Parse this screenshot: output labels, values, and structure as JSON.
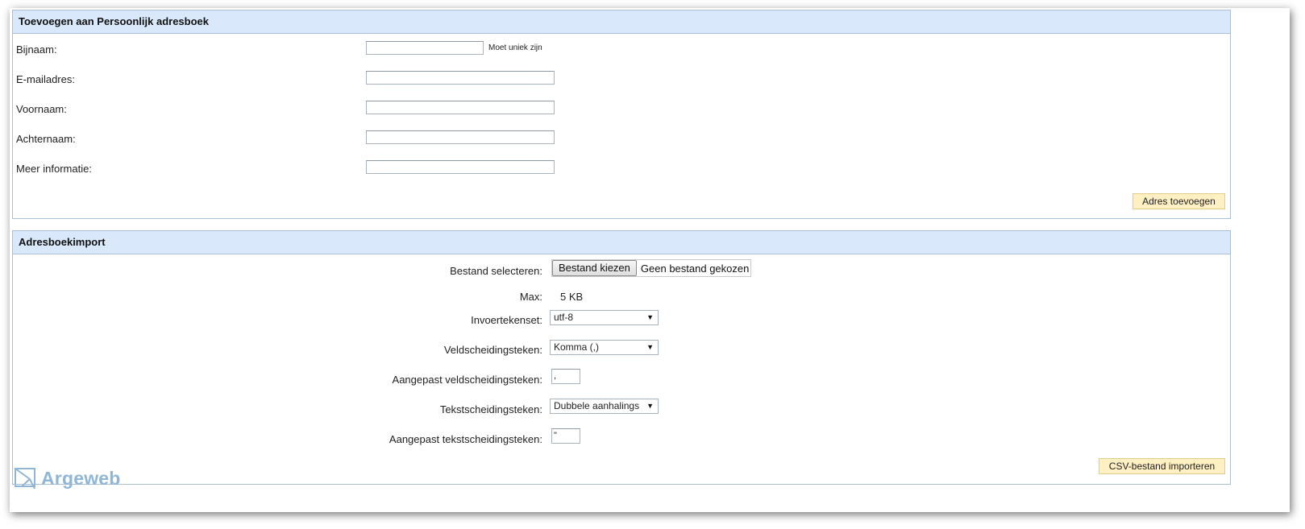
{
  "add_panel": {
    "title": "Toevoegen aan Persoonlijk adresboek",
    "fields": [
      {
        "label": "Bijnaam:",
        "value": "",
        "hint": "Moet uniek zijn"
      },
      {
        "label": "E-mailadres:",
        "value": ""
      },
      {
        "label": "Voornaam:",
        "value": ""
      },
      {
        "label": "Achternaam:",
        "value": ""
      },
      {
        "label": "Meer informatie:",
        "value": ""
      }
    ],
    "submit_label": "Adres toevoegen"
  },
  "import_panel": {
    "title": "Adresboekimport",
    "file_label": "Bestand selecteren:",
    "file_button": "Bestand kiezen",
    "file_status": "Geen bestand gekozen",
    "max_label": "Max:",
    "max_value": "5 KB",
    "charset_label": "Invoertekenset:",
    "charset_value": "utf-8",
    "field_sep_label": "Veldscheidingsteken:",
    "field_sep_value": "Komma (,)",
    "custom_field_sep_label": "Aangepast veldscheidingsteken:",
    "custom_field_sep_value": ",",
    "text_sep_label": "Tekstscheidingsteken:",
    "text_sep_value": "Dubbele aanhalings",
    "custom_text_sep_label": "Aangepast tekstscheidingsteken:",
    "custom_text_sep_value": "\"",
    "submit_label": "CSV-bestand importeren"
  },
  "brand": {
    "name": "Argeweb"
  },
  "colors": {
    "header_bg": "#d9e8fb",
    "panel_border": "#a9bfd6",
    "button_bg": "#fff0c4",
    "brand": "#8fb6d6"
  }
}
